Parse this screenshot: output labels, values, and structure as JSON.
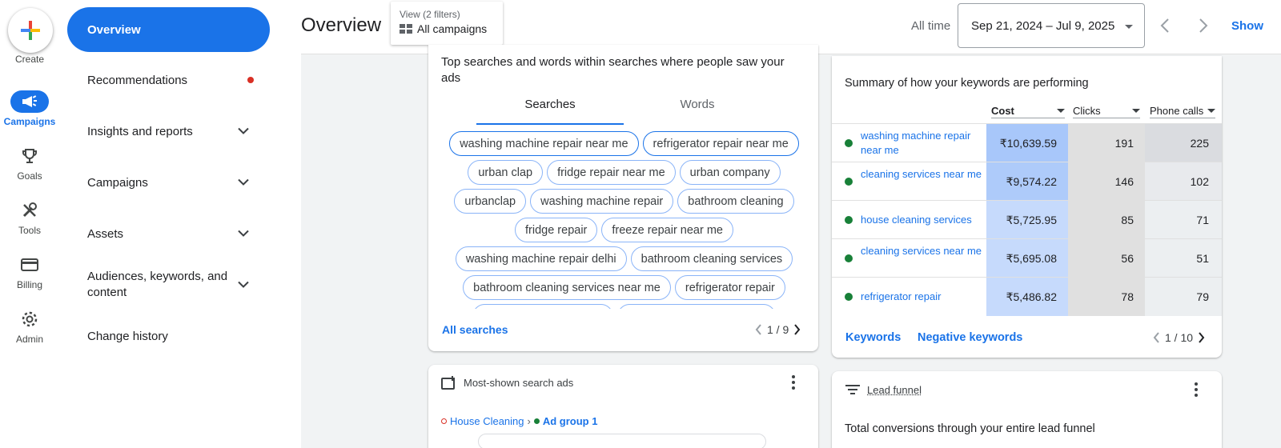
{
  "rail": {
    "create_label": "Create",
    "items": [
      {
        "label": "Campaigns",
        "icon": "campaigns-megaphone-icon",
        "active": true
      },
      {
        "label": "Goals",
        "icon": "trophy-icon"
      },
      {
        "label": "Tools",
        "icon": "tools-icon"
      },
      {
        "label": "Billing",
        "icon": "credit-card-icon"
      },
      {
        "label": "Admin",
        "icon": "gear-icon"
      }
    ]
  },
  "nav": {
    "items": [
      {
        "label": "Overview",
        "active": true
      },
      {
        "label": "Recommendations",
        "dot": true
      },
      {
        "label": "Insights and reports",
        "expandable": true
      },
      {
        "label": "Campaigns",
        "expandable": true
      },
      {
        "label": "Assets",
        "expandable": true
      },
      {
        "label": "Audiences, keywords, and content",
        "expandable": true
      },
      {
        "label": "Change history"
      }
    ]
  },
  "header": {
    "title": "Overview",
    "view_sub": "View (2 filters)",
    "view_main": "All campaigns",
    "range_label": "All time",
    "date_range": "Sep 21, 2024 – Jul 9, 2025",
    "show_label": "Show"
  },
  "searches": {
    "title": "Top searches and words within searches where people saw your ads",
    "tabs": [
      "Searches",
      "Words"
    ],
    "chips": [
      "washing machine repair near me",
      "refrigerator repair near me",
      "urban clap",
      "fridge repair near me",
      "urban company",
      "urbanclap",
      "washing machine repair",
      "bathroom cleaning",
      "fridge repair",
      "freeze repair near me",
      "washing machine repair delhi",
      "bathroom cleaning services",
      "bathroom cleaning services near me",
      "refrigerator repair"
    ],
    "all_link": "All searches",
    "pager": "1 / 9"
  },
  "keywords": {
    "title": "Summary of how your keywords are performing",
    "columns": {
      "cost": "Cost",
      "clicks": "Clicks",
      "calls": "Phone calls"
    },
    "rows": [
      {
        "name": "washing machine repair near me",
        "cost": "₹10,639.59",
        "clicks": "191",
        "calls": "225"
      },
      {
        "name": "cleaning services near me",
        "cost": "₹9,574.22",
        "clicks": "146",
        "calls": "102"
      },
      {
        "name": "house cleaning services",
        "cost": "₹5,725.95",
        "clicks": "85",
        "calls": "71"
      },
      {
        "name": "cleaning services near me",
        "cost": "₹5,695.08",
        "clicks": "56",
        "calls": "51"
      },
      {
        "name": "refrigerator repair",
        "cost": "₹5,486.82",
        "clicks": "78",
        "calls": "79"
      }
    ],
    "cost_shades": [
      "#a8c7fa",
      "#aecbfa",
      "#c6dafc",
      "#c6dafc",
      "#c6dafc"
    ],
    "calls_shades": [
      "#dadce0",
      "#e8eaed",
      "#eceff1",
      "#eceff1",
      "#eceff1"
    ],
    "links": {
      "keywords": "Keywords",
      "negative": "Negative keywords"
    },
    "pager": "1 / 10"
  },
  "ads": {
    "title": "Most-shown search ads",
    "campaign": "House Cleaning",
    "adgroup": "Ad group 1"
  },
  "funnel": {
    "title": "Lead funnel",
    "subtitle": "Total conversions through your entire lead funnel"
  },
  "colors": {
    "accent": "#1a73e8",
    "enabled_green": "#188038",
    "alert_red": "#d93025"
  }
}
